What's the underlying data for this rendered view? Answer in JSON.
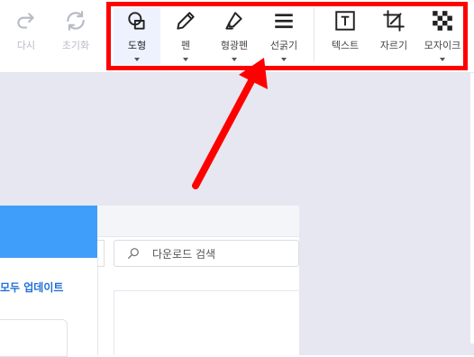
{
  "toolbar": {
    "undo_partial": {
      "label": "다시",
      "icon": "redo-icon",
      "enabled": false
    },
    "reset": {
      "label": "초기화",
      "icon": "reset-icon",
      "enabled": false
    },
    "tools": [
      {
        "label": "도형",
        "icon": "shape-icon",
        "has_dropdown": true,
        "selected": true
      },
      {
        "label": "펜",
        "icon": "pen-icon",
        "has_dropdown": true
      },
      {
        "label": "형광펜",
        "icon": "highlighter-icon",
        "has_dropdown": true
      },
      {
        "label": "선굵기",
        "icon": "line-weight-icon",
        "has_dropdown": true
      },
      {
        "label": "텍스트",
        "icon": "text-icon",
        "has_dropdown": false
      },
      {
        "label": "자르기",
        "icon": "crop-icon",
        "has_dropdown": false
      },
      {
        "label": "모자이크",
        "icon": "mosaic-icon",
        "has_dropdown": true
      }
    ]
  },
  "annotation": {
    "highlight_color": "#ff0000",
    "arrow_color": "#ff0000"
  },
  "app": {
    "update_link": "모두 업데이트",
    "search": {
      "placeholder": "다운로드 검색",
      "icon": "search-icon"
    },
    "accent": "#3f9ef9"
  }
}
